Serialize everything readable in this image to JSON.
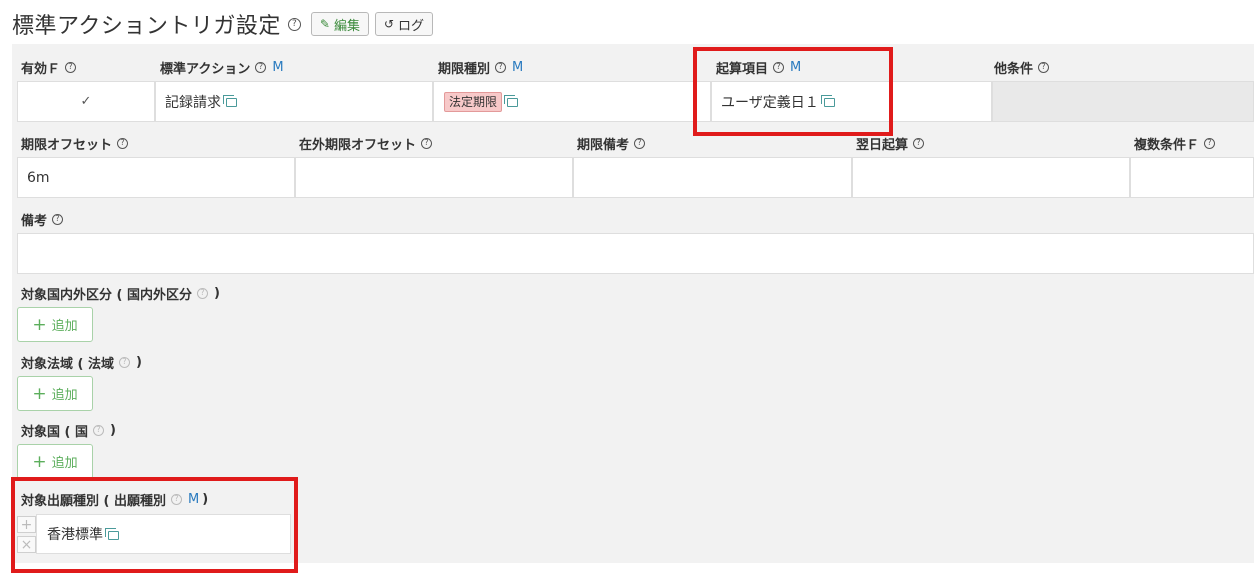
{
  "page": {
    "title": "標準アクショントリガ設定",
    "edit_label": "編集",
    "log_label": "ログ",
    "help_glyph": "?"
  },
  "row1": {
    "headers": {
      "enabled": "有効Ｆ",
      "standard_action": "標準アクション",
      "deadline_type": "期限種別",
      "start_item": "起算項目",
      "other_conditions": "他条件"
    },
    "m_label": "M",
    "values": {
      "enabled": "✓",
      "standard_action": "記録請求",
      "deadline_type": "法定期限",
      "start_item": "ユーザ定義日１",
      "other_conditions": ""
    }
  },
  "row2": {
    "headers": {
      "deadline_offset": "期限オフセット",
      "foreign_deadline_offset": "在外期限オフセット",
      "deadline_note": "期限備考",
      "next_day_start": "翌日起算",
      "multiple_conditions": "複数条件Ｆ"
    },
    "values": {
      "deadline_offset": "6m",
      "foreign_deadline_offset": "",
      "deadline_note": "",
      "next_day_start": "",
      "multiple_conditions": ""
    }
  },
  "remarks": {
    "label": "備考",
    "value": ""
  },
  "sections": {
    "domestic_foreign": {
      "label": "対象国内外区分 ( 国内外区分",
      "close": ")",
      "add_label": "追加"
    },
    "jurisdiction": {
      "label": "対象法域 ( 法域",
      "close": ")",
      "add_label": "追加"
    },
    "country": {
      "label": "対象国 ( 国",
      "close": ")",
      "add_label": "追加"
    },
    "application_type": {
      "label": "対象出願種別 ( 出願種別",
      "close": ")",
      "m_label": "M",
      "item": "香港標準"
    }
  },
  "colors": {
    "highlight": "#e01b1b",
    "link": "#2a7bbf",
    "add_green": "#5cae5c",
    "tag_bg": "#f7c9c9"
  }
}
